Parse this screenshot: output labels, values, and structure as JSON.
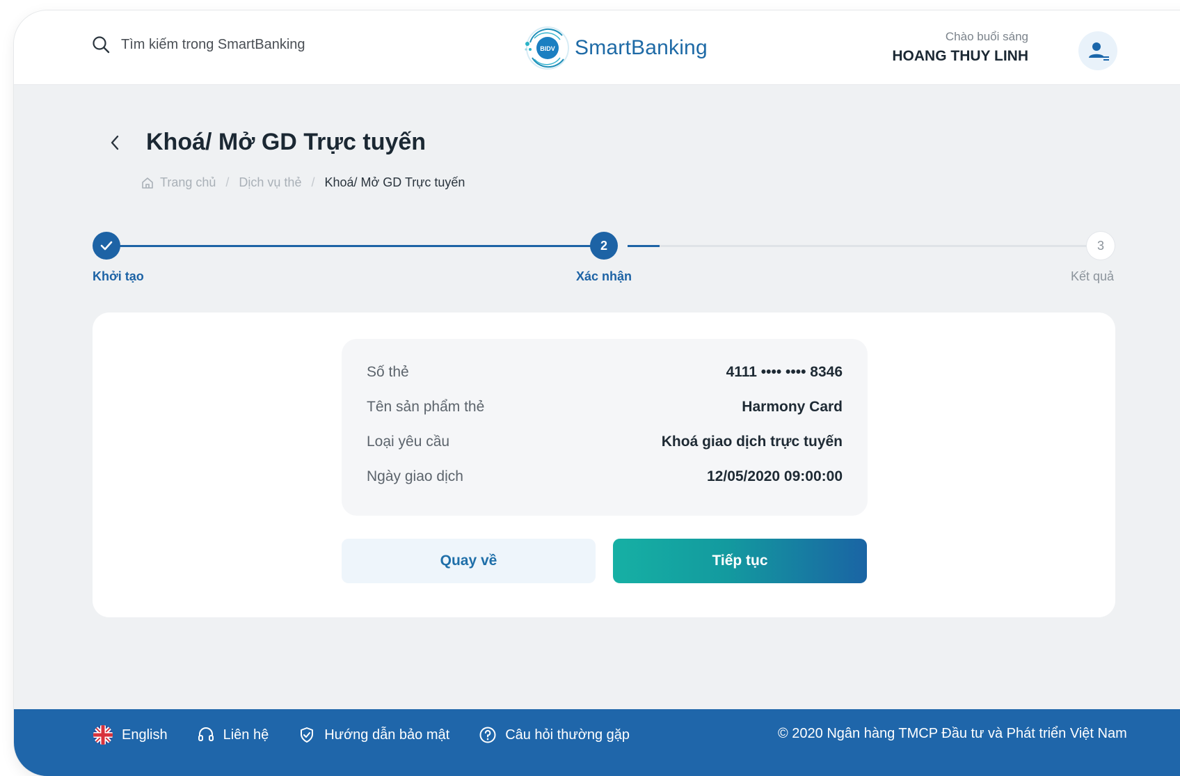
{
  "header": {
    "search_placeholder": "Tìm kiếm trong SmartBanking",
    "logo_badge": "BIDV",
    "brand": "SmartBanking",
    "greeting": "Chào buổi sáng",
    "user_name": "HOANG THUY LINH"
  },
  "page": {
    "title": "Khoá/ Mở GD Trực tuyến",
    "breadcrumb": [
      "Trang chủ",
      "Dịch vụ thẻ",
      "Khoá/ Mở GD Trực tuyến"
    ]
  },
  "stepper": {
    "steps": [
      {
        "label": "Khởi tạo",
        "state": "done"
      },
      {
        "label": "Xác nhận",
        "number": "2",
        "state": "active"
      },
      {
        "label": "Kết quả",
        "number": "3",
        "state": "pending"
      }
    ]
  },
  "details": [
    {
      "label": "Số thẻ",
      "value": "4111 •••• •••• 8346"
    },
    {
      "label": "Tên sản phẩm thẻ",
      "value": "Harmony Card"
    },
    {
      "label": "Loại yêu cầu",
      "value": "Khoá giao dịch trực tuyến"
    },
    {
      "label": "Ngày giao dịch",
      "value": "12/05/2020 09:00:00"
    }
  ],
  "actions": {
    "back_label": "Quay về",
    "next_label": "Tiếp tục"
  },
  "footer": {
    "links": [
      "English",
      "Liên hệ",
      "Hướng dẫn bảo mật",
      "Câu hỏi thường gặp"
    ],
    "copyright": "© 2020 Ngân hàng TMCP Đầu tư và Phát triển Việt Nam"
  },
  "colors": {
    "primary": "#1f66aa",
    "accent_teal": "#16b0a4",
    "background": "#eff1f3"
  }
}
